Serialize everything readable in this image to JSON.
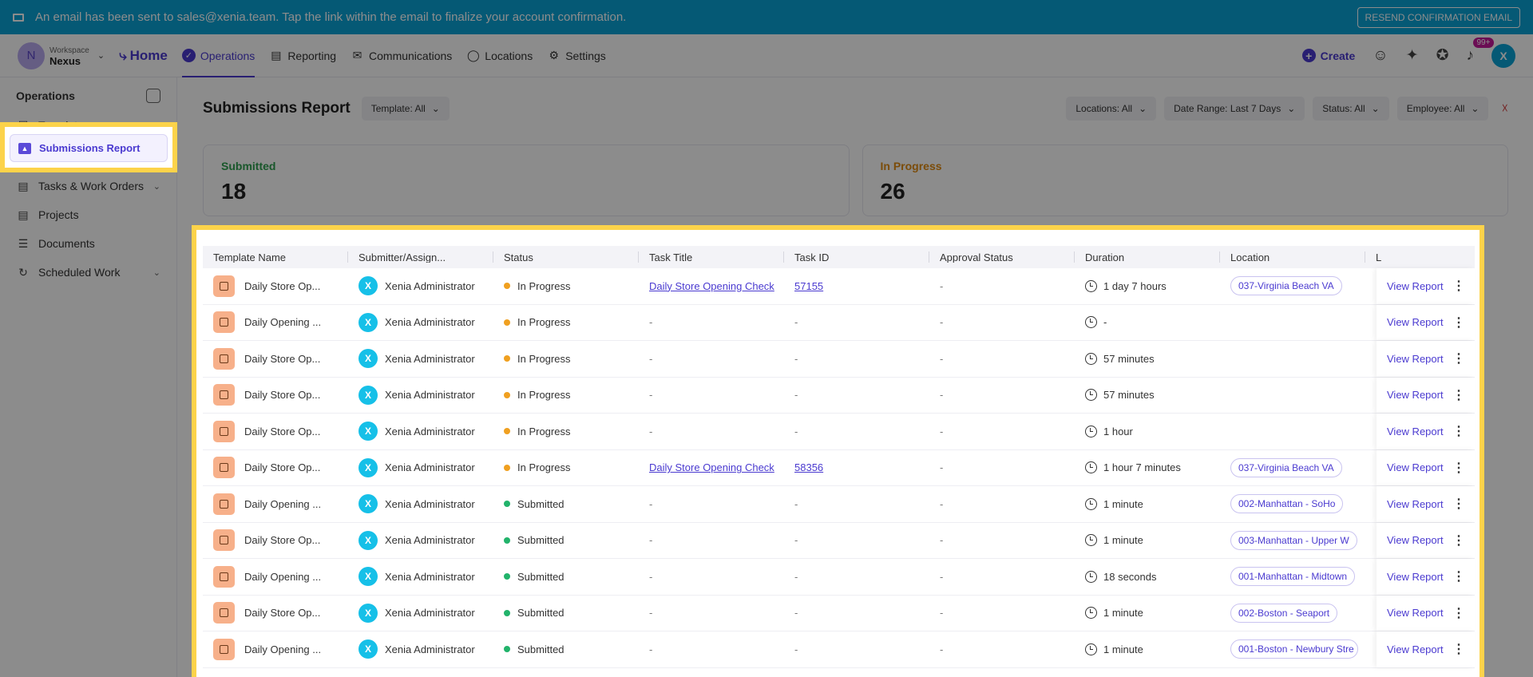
{
  "banner": {
    "message": "An email has been sent to sales@xenia.team. Tap the link within the email to finalize your account confirmation.",
    "resend_label": "RESEND CONFIRMATION EMAIL"
  },
  "workspace": {
    "caption": "Workspace",
    "name": "Nexus",
    "initial": "N"
  },
  "nav": {
    "home": "Home",
    "items": [
      "Operations",
      "Reporting",
      "Communications",
      "Locations",
      "Settings"
    ],
    "create": "Create",
    "notification_badge": "99+",
    "user_initial": "X"
  },
  "sidebar": {
    "title": "Operations",
    "items": [
      "Templates",
      "Submissions Report",
      "Tasks & Work Orders",
      "Projects",
      "Documents",
      "Scheduled Work"
    ]
  },
  "page": {
    "title": "Submissions Report",
    "template_filter": "Template: All",
    "filters": [
      "Locations: All",
      "Date Range: Last 7 Days",
      "Status: All",
      "Employee: All"
    ]
  },
  "stats": [
    {
      "label": "Submitted",
      "value": "18",
      "color": "#2e9e4f"
    },
    {
      "label": "In Progress",
      "value": "26",
      "color": "#e08b12"
    }
  ],
  "table": {
    "columns": [
      "Template Name",
      "Submitter/Assign...",
      "Status",
      "Task Title",
      "Task ID",
      "Approval Status",
      "Duration",
      "Location",
      "L"
    ],
    "action_label": "View Report",
    "rows": [
      {
        "template": "Daily Store Op...",
        "submitter": "Xenia Administrator",
        "status": "In Progress",
        "task_title": "Daily Store Opening Check",
        "task_id": "57155",
        "approval": "-",
        "duration": "1 day 7 hours",
        "location": "037-Virginia Beach VA"
      },
      {
        "template": "Daily Opening ...",
        "submitter": "Xenia Administrator",
        "status": "In Progress",
        "task_title": "-",
        "task_id": "-",
        "approval": "-",
        "duration": "-",
        "location": ""
      },
      {
        "template": "Daily Store Op...",
        "submitter": "Xenia Administrator",
        "status": "In Progress",
        "task_title": "-",
        "task_id": "-",
        "approval": "-",
        "duration": "57 minutes",
        "location": ""
      },
      {
        "template": "Daily Store Op...",
        "submitter": "Xenia Administrator",
        "status": "In Progress",
        "task_title": "-",
        "task_id": "-",
        "approval": "-",
        "duration": "57 minutes",
        "location": ""
      },
      {
        "template": "Daily Store Op...",
        "submitter": "Xenia Administrator",
        "status": "In Progress",
        "task_title": "-",
        "task_id": "-",
        "approval": "-",
        "duration": "1 hour",
        "location": ""
      },
      {
        "template": "Daily Store Op...",
        "submitter": "Xenia Administrator",
        "status": "In Progress",
        "task_title": "Daily Store Opening Check",
        "task_id": "58356",
        "approval": "-",
        "duration": "1 hour 7 minutes",
        "location": "037-Virginia Beach VA"
      },
      {
        "template": "Daily Opening ...",
        "submitter": "Xenia Administrator",
        "status": "Submitted",
        "task_title": "-",
        "task_id": "-",
        "approval": "-",
        "duration": "1 minute",
        "location": "002-Manhattan - SoHo"
      },
      {
        "template": "Daily Store Op...",
        "submitter": "Xenia Administrator",
        "status": "Submitted",
        "task_title": "-",
        "task_id": "-",
        "approval": "-",
        "duration": "1 minute",
        "location": "003-Manhattan - Upper W"
      },
      {
        "template": "Daily Opening ...",
        "submitter": "Xenia Administrator",
        "status": "Submitted",
        "task_title": "-",
        "task_id": "-",
        "approval": "-",
        "duration": "18 seconds",
        "location": "001-Manhattan - Midtown"
      },
      {
        "template": "Daily Store Op...",
        "submitter": "Xenia Administrator",
        "status": "Submitted",
        "task_title": "-",
        "task_id": "-",
        "approval": "-",
        "duration": "1 minute",
        "location": "002-Boston - Seaport"
      },
      {
        "template": "Daily Opening ...",
        "submitter": "Xenia Administrator",
        "status": "Submitted",
        "task_title": "-",
        "task_id": "-",
        "approval": "-",
        "duration": "1 minute",
        "location": "001-Boston - Newbury Stre"
      }
    ]
  },
  "colors": {
    "accent": "#4a3ad0",
    "in_progress": "#f0a020",
    "submitted": "#22b36b",
    "highlight": "#fcd34a",
    "banner": "#0aa3d6"
  }
}
